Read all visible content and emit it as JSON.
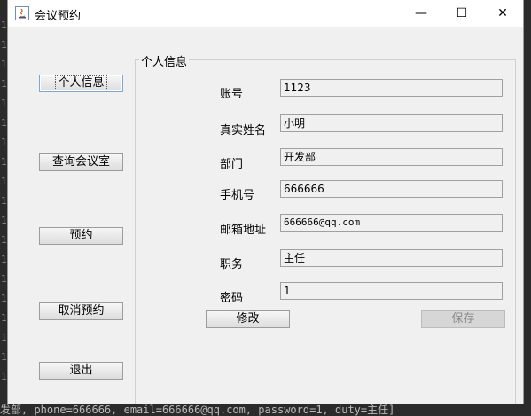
{
  "window": {
    "title": "会议预约",
    "controls": {
      "minimize": "—",
      "maximize": "☐",
      "close": "✕"
    }
  },
  "sidebar": {
    "items": [
      {
        "label": "个人信息"
      },
      {
        "label": "查询会议室"
      },
      {
        "label": "预约"
      },
      {
        "label": "取消预约"
      },
      {
        "label": "退出"
      }
    ]
  },
  "profile": {
    "group_title": "个人信息",
    "fields": [
      {
        "label": "账号",
        "value": "1123"
      },
      {
        "label": "真实姓名",
        "value": "小明"
      },
      {
        "label": "部门",
        "value": "开发部"
      },
      {
        "label": "手机号",
        "value": "666666"
      },
      {
        "label": "邮箱地址",
        "value": "666666@qq.com"
      },
      {
        "label": "职务",
        "value": "主任"
      },
      {
        "label": "密码",
        "value": "1"
      }
    ],
    "modify_label": "修改",
    "save_label": "保存"
  },
  "background": {
    "console_line": "发部, phone=666666, email=666666@qq.com, password=1, duty=主任]"
  }
}
